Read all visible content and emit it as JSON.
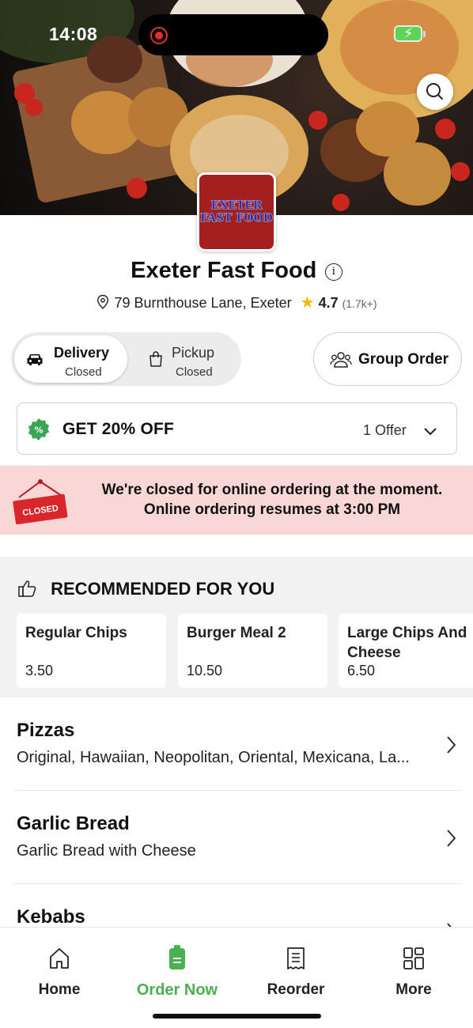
{
  "status_bar": {
    "time": "14:08"
  },
  "restaurant": {
    "logo_text": "EXETER FAST FOOD",
    "name": "Exeter Fast Food",
    "address": "79 Burnthouse Lane, Exeter",
    "rating": "4.7",
    "rating_count": "(1.7k+)"
  },
  "order_mode": {
    "delivery": {
      "title": "Delivery",
      "status": "Closed",
      "selected": true
    },
    "pickup": {
      "title": "Pickup",
      "status": "Closed",
      "selected": false
    }
  },
  "group_order": {
    "label": "Group Order"
  },
  "offer": {
    "title": "GET 20% OFF",
    "count": "1 Offer"
  },
  "closed_banner": {
    "sign_text": "CLOSED",
    "line1": "We're closed for online ordering at the moment.",
    "line2": "Online ordering resumes at 3:00 PM"
  },
  "recommended": {
    "heading": "RECOMMENDED FOR YOU",
    "items": [
      {
        "name": "Regular Chips",
        "price": "3.50"
      },
      {
        "name": "Burger Meal 2",
        "price": "10.50"
      },
      {
        "name": "Large Chips And Cheese",
        "price": "6.50"
      }
    ]
  },
  "categories": [
    {
      "name": "Pizzas",
      "description": "Original, Hawaiian, Neopolitan, Oriental, Mexicana, La..."
    },
    {
      "name": "Garlic Bread",
      "description": "Garlic Bread with Cheese"
    },
    {
      "name": "Kebabs",
      "description": ""
    }
  ],
  "bottom_nav": {
    "items": [
      {
        "label": "Home",
        "icon": "home-icon"
      },
      {
        "label": "Order Now",
        "icon": "order-bag-icon",
        "active": true
      },
      {
        "label": "Reorder",
        "icon": "receipt-icon"
      },
      {
        "label": "More",
        "icon": "grid-icon"
      }
    ]
  },
  "colors": {
    "accent": "#4caf50",
    "closed_bg": "#f9d7d7",
    "logo_bg": "#a3201f",
    "star": "#f7b500"
  }
}
